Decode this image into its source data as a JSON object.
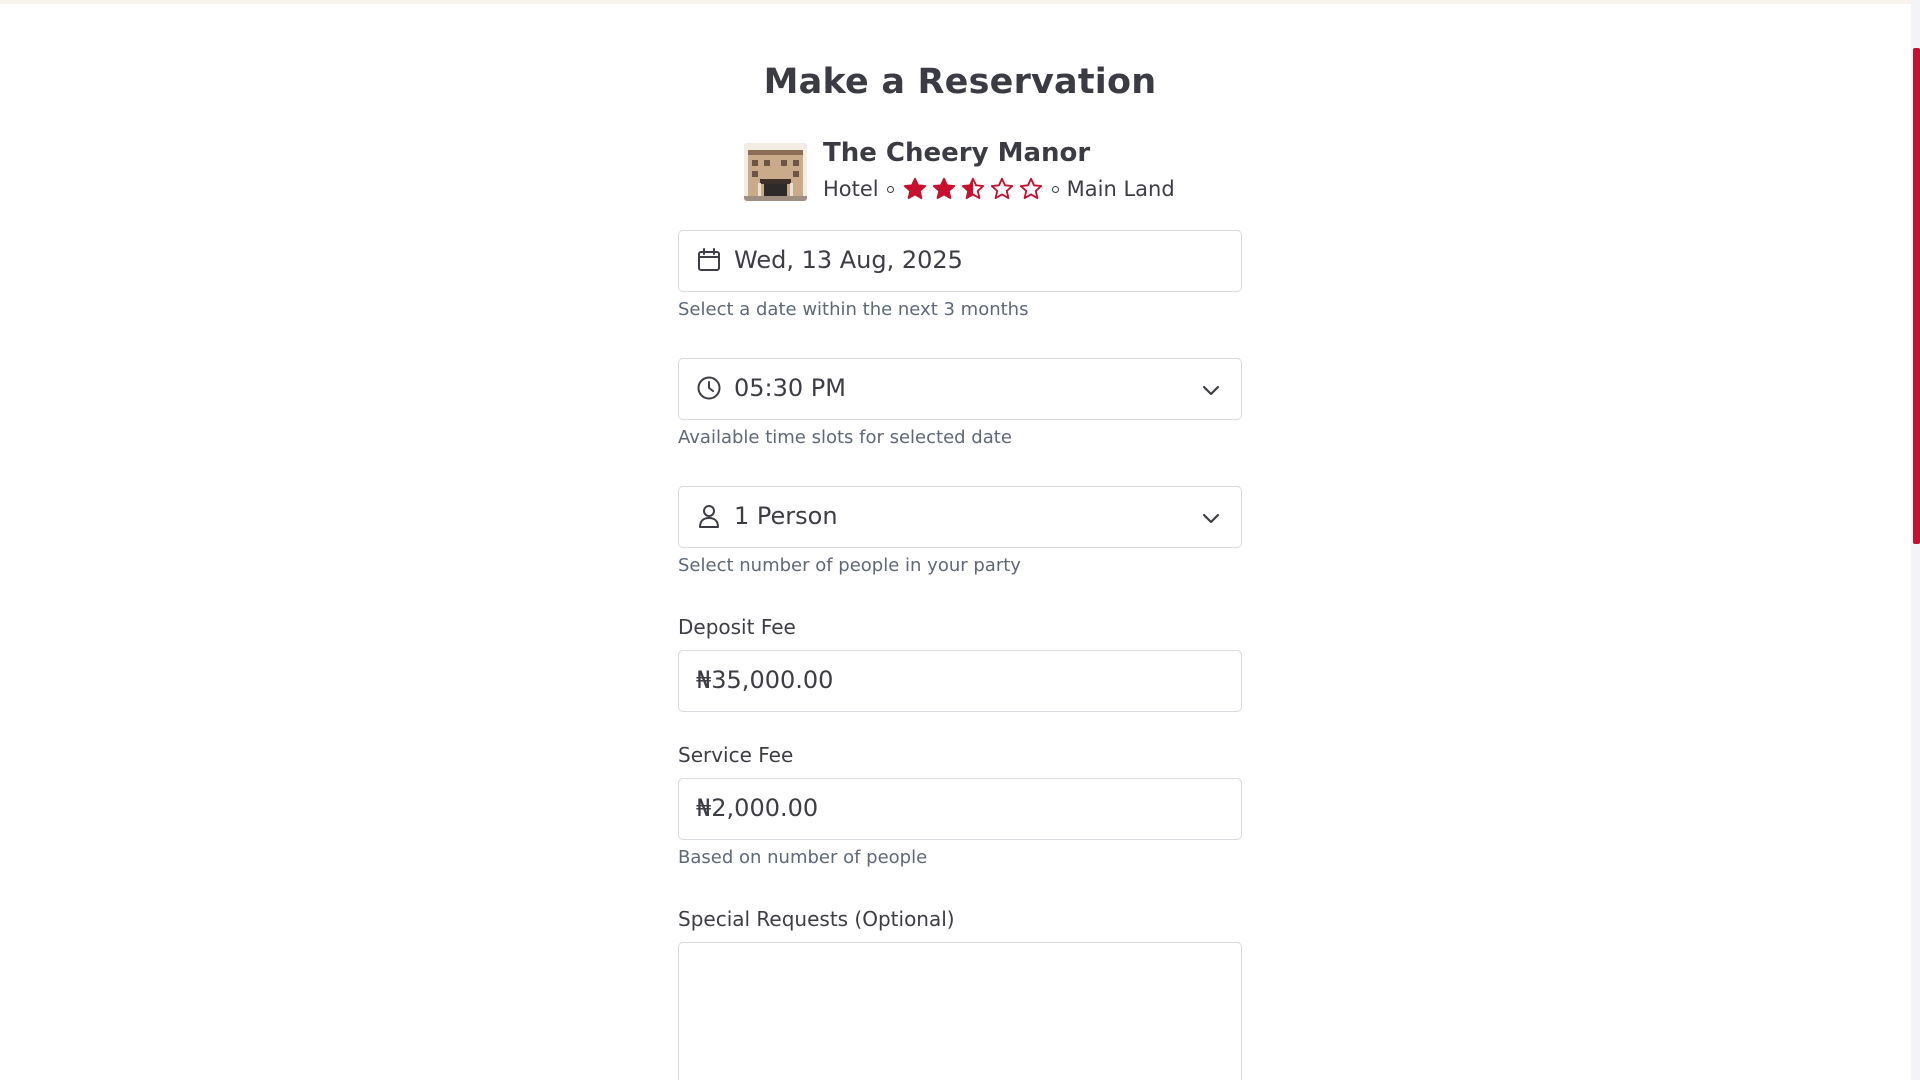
{
  "page": {
    "title": "Make a Reservation"
  },
  "venue": {
    "name": "The Cheery Manor",
    "type": "Hotel",
    "rating": 2.5,
    "rating_max": 5,
    "location": "Main Land"
  },
  "date_field": {
    "value": "Wed, 13 Aug, 2025",
    "icon": "calendar-icon",
    "helper": "Select a date within the next 3 months"
  },
  "time_field": {
    "value": "05:30 PM",
    "icon": "clock-icon",
    "helper": "Available time slots for selected date"
  },
  "party_field": {
    "value": "1 Person",
    "icon": "person-icon",
    "helper": "Select number of people in your party"
  },
  "deposit": {
    "label": "Deposit Fee",
    "value": "₦35,000.00"
  },
  "service": {
    "label": "Service Fee",
    "value": "₦2,000.00",
    "helper": "Based on number of people"
  },
  "special_requests": {
    "label": "Special Requests (Optional)",
    "value": ""
  },
  "colors": {
    "accent": "#c8102e",
    "text": "#3d3d45",
    "helper_text": "#5f6878",
    "border": "#d9dae0"
  }
}
